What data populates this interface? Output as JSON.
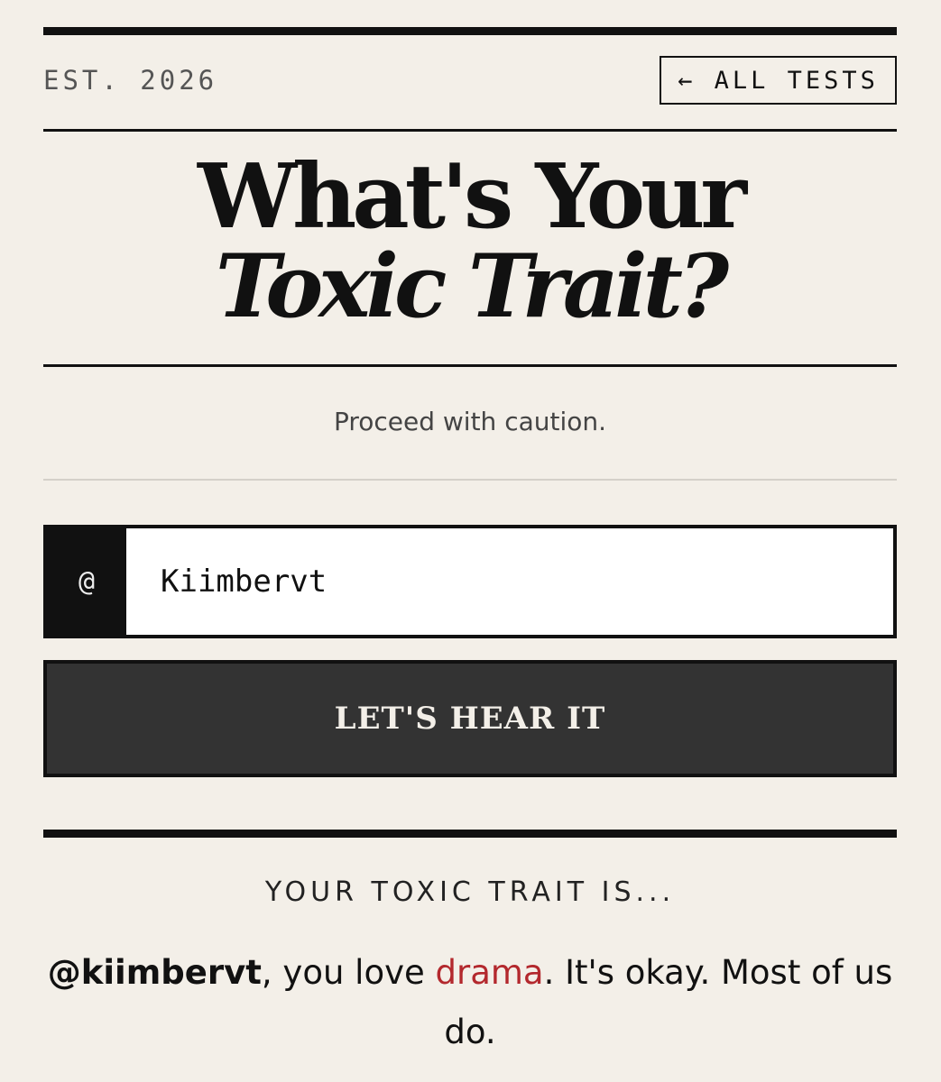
{
  "header": {
    "est_label": "EST. 2026",
    "all_tests_label": "← ALL TESTS"
  },
  "title": {
    "line1": "What's Your",
    "line2": "Toxic Trait?"
  },
  "subtitle": "Proceed with caution.",
  "form": {
    "prefix": "@",
    "handle_value": "Kiimbervt",
    "submit_label": "LET'S HEAR IT"
  },
  "result": {
    "label": "YOUR TOXIC TRAIT IS...",
    "username": "@kiimbervt",
    "text_before": ", you love ",
    "trait": "drama",
    "text_after": ". It's okay. Most of us do."
  },
  "colors": {
    "background": "#f3efe8",
    "ink": "#111111",
    "button": "#333333",
    "accent": "#b3282d"
  }
}
